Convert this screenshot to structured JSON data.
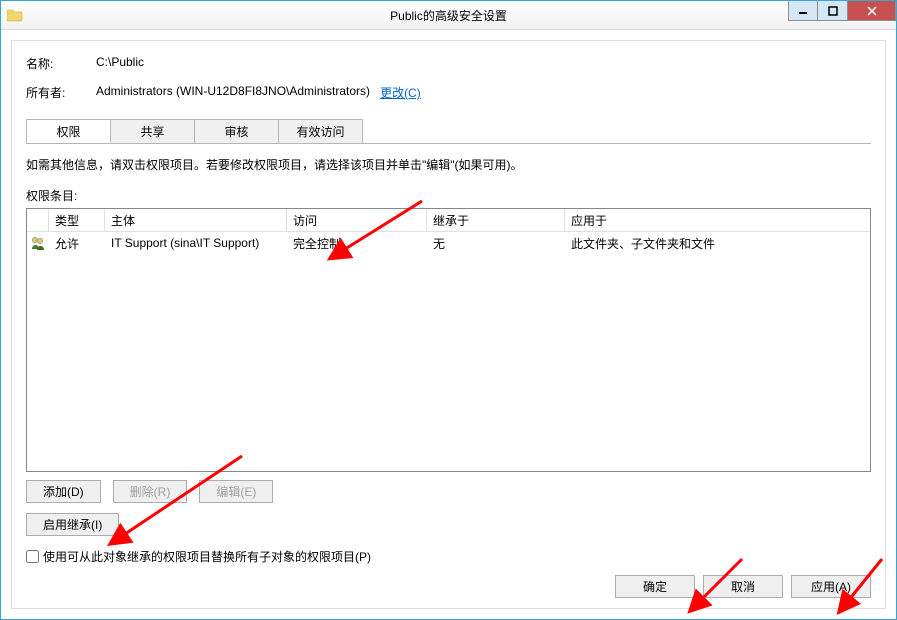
{
  "window": {
    "title": "Public的高级安全设置"
  },
  "name_row": {
    "label": "名称:",
    "value": "C:\\Public"
  },
  "owner_row": {
    "label": "所有者:",
    "value": "Administrators (WIN-U12D8FI8JNO\\Administrators)",
    "change_link": "更改(C)"
  },
  "tabs": {
    "permission": "权限",
    "share": "共享",
    "audit": "审核",
    "effective": "有效访问"
  },
  "hint": "如需其他信息，请双击权限项目。若要修改权限项目，请选择该项目并单击\"编辑\"(如果可用)。",
  "list_label": "权限条目:",
  "columns": {
    "type": "类型",
    "principal": "主体",
    "access": "访问",
    "inherited": "继承于",
    "applies": "应用于"
  },
  "rows": [
    {
      "type": "允许",
      "principal": "IT Support (sina\\IT Support)",
      "access": "完全控制",
      "inherited": "无",
      "applies": "此文件夹、子文件夹和文件"
    }
  ],
  "buttons": {
    "add": "添加(D)",
    "remove": "删除(R)",
    "edit": "编辑(E)",
    "enable_inherit": "启用继承(I)"
  },
  "checkbox_label": "使用可从此对象继承的权限项目替换所有子对象的权限项目(P)",
  "footer": {
    "ok": "确定",
    "cancel": "取消",
    "apply": "应用(A)"
  }
}
